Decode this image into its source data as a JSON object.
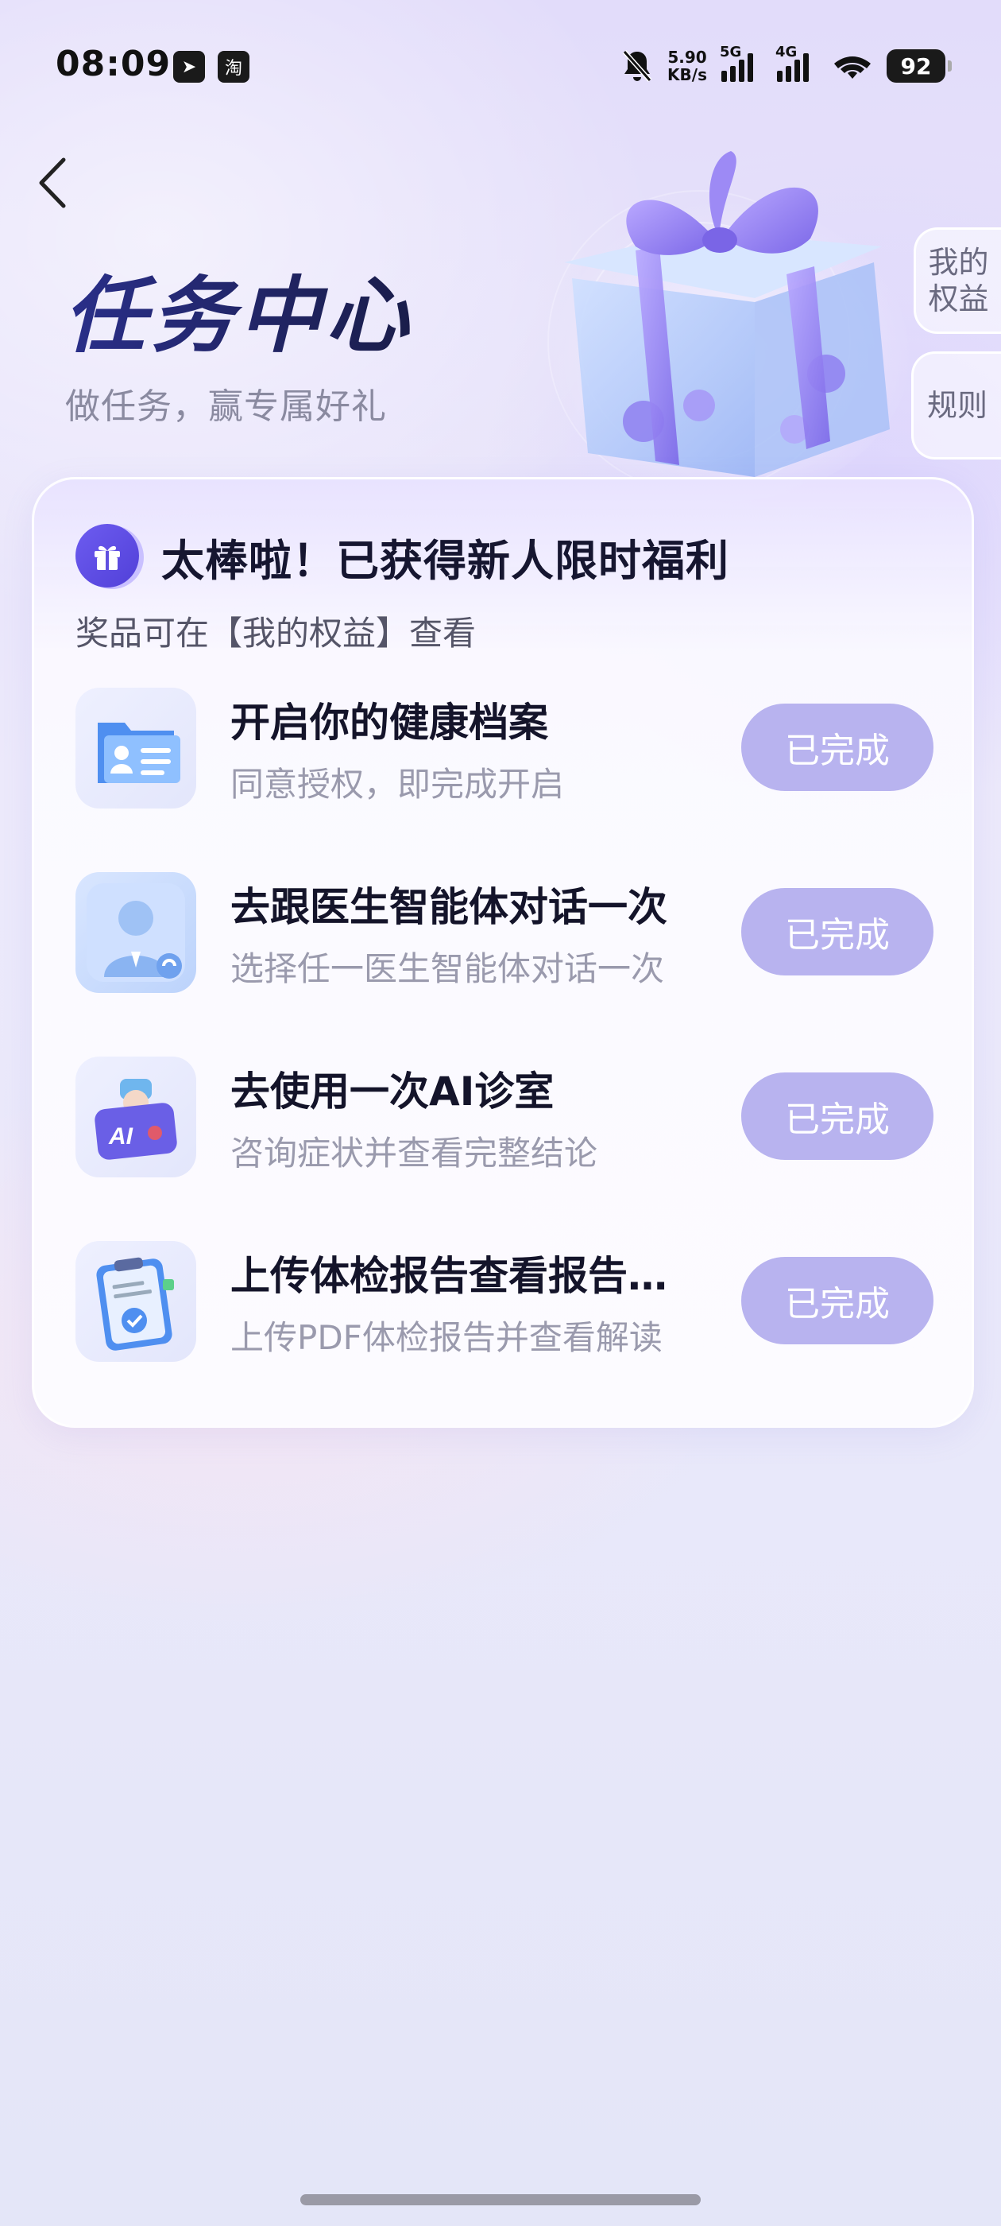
{
  "status_bar": {
    "time": "08:09",
    "app1": "➤",
    "app2": "淘",
    "net_speed_value": "5.90",
    "net_speed_unit": "KB/s",
    "signal1_label": "5G",
    "signal2_label": "4G",
    "battery": "92"
  },
  "header": {
    "title": "任务中心",
    "subtitle": "做任务，赢专属好礼"
  },
  "side_tabs": {
    "benefits": "我的权益",
    "rules": "规则"
  },
  "card": {
    "title": "太棒啦！已获得新人限时福利",
    "subtitle": "奖品可在【我的权益】查看",
    "tasks": [
      {
        "title": "开启你的健康档案",
        "desc": "同意授权，即完成开启",
        "button": "已完成",
        "icon": "health-folder-icon"
      },
      {
        "title": "去跟医生智能体对话一次",
        "desc": "选择任一医生智能体对话一次",
        "button": "已完成",
        "icon": "doctor-icon"
      },
      {
        "title": "去使用一次AI诊室",
        "desc": "咨询症状并查看完整结论",
        "button": "已完成",
        "icon": "ai-clinic-icon"
      },
      {
        "title": "上传体检报告查看报告解读",
        "desc": "上传PDF体检报告并查看解读",
        "button": "已完成",
        "icon": "report-clipboard-icon"
      }
    ]
  },
  "colors": {
    "accent": "#5b4be0",
    "button_done": "#b8b3ef",
    "title": "#1f2360"
  }
}
